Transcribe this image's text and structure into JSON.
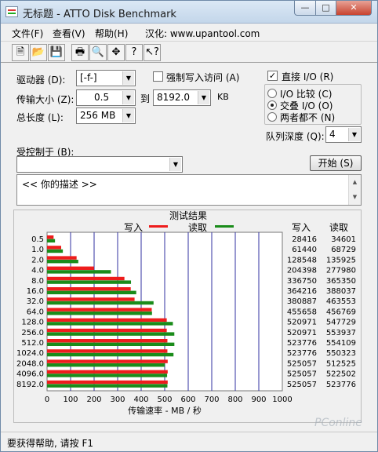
{
  "window": {
    "title": "无标题 - ATTO Disk Benchmark"
  },
  "menu": {
    "file": "文件(F)",
    "view": "查看(V)",
    "help": "帮助(H)",
    "site": "汉化: www.upantool.com"
  },
  "toolbar_icons": [
    "new-doc-icon",
    "open-folder-icon",
    "save-disk-icon",
    "print-icon",
    "print-preview-icon",
    "move-cross-icon",
    "help-question-icon",
    "context-help-icon"
  ],
  "settings": {
    "drive_label": "驱动器 (D):",
    "drive_value": "[-f-]",
    "force_write_label": "强制写入访问 (A)",
    "force_write_checked": false,
    "transfer_label": "传输大小 (Z):",
    "transfer_from": "0.5",
    "to_label": "到",
    "transfer_to": "8192.0",
    "unit": "KB",
    "total_label": "总长度 (L):",
    "total_value": "256 MB",
    "direct_io_label": "直接 I/O (R)",
    "direct_io_checked": true,
    "io_compare_label": "I/O 比较 (C)",
    "io_overlap_label": "交叠 I/O (O)",
    "io_neither_label": "两者都不 (N)",
    "io_mode": "overlap",
    "queue_label": "队列深度 (Q):",
    "queue_value": "4",
    "controlled_label": "受控制于 (B):",
    "controlled_value": "",
    "start_button": "开始 (S)",
    "description": "<<  你的描述  >>"
  },
  "results": {
    "title": "测试结果",
    "write_legend": "写入",
    "read_legend": "读取",
    "col_write": "写入",
    "col_read": "读取",
    "write_color": "#ee1c1c",
    "read_color": "#1a8c1a",
    "grid_color": "#3030a0"
  },
  "chart_data": {
    "type": "bar",
    "orientation": "horizontal",
    "categories": [
      "0.5",
      "1.0",
      "2.0",
      "4.0",
      "8.0",
      "16.0",
      "32.0",
      "64.0",
      "128.0",
      "256.0",
      "512.0",
      "1024.0",
      "2048.0",
      "4096.0",
      "8192.0"
    ],
    "series": [
      {
        "name": "写入",
        "values": [
          28416,
          61440,
          128548,
          204398,
          336750,
          364216,
          380887,
          455658,
          520971,
          520971,
          523776,
          523776,
          525057,
          525057,
          525057
        ]
      },
      {
        "name": "读取",
        "values": [
          34601,
          68729,
          135925,
          277980,
          365350,
          388037,
          463553,
          456769,
          547729,
          553937,
          554109,
          550323,
          512525,
          522502,
          523776
        ]
      }
    ],
    "xlabel": "传输速率 - MB / 秒",
    "xticks": [
      0,
      100,
      200,
      300,
      400,
      500,
      600,
      700,
      800,
      900,
      1000
    ],
    "xlim": [
      0,
      1000
    ]
  },
  "status": {
    "text": "要获得帮助, 请按 F1"
  },
  "watermark": "PConline"
}
